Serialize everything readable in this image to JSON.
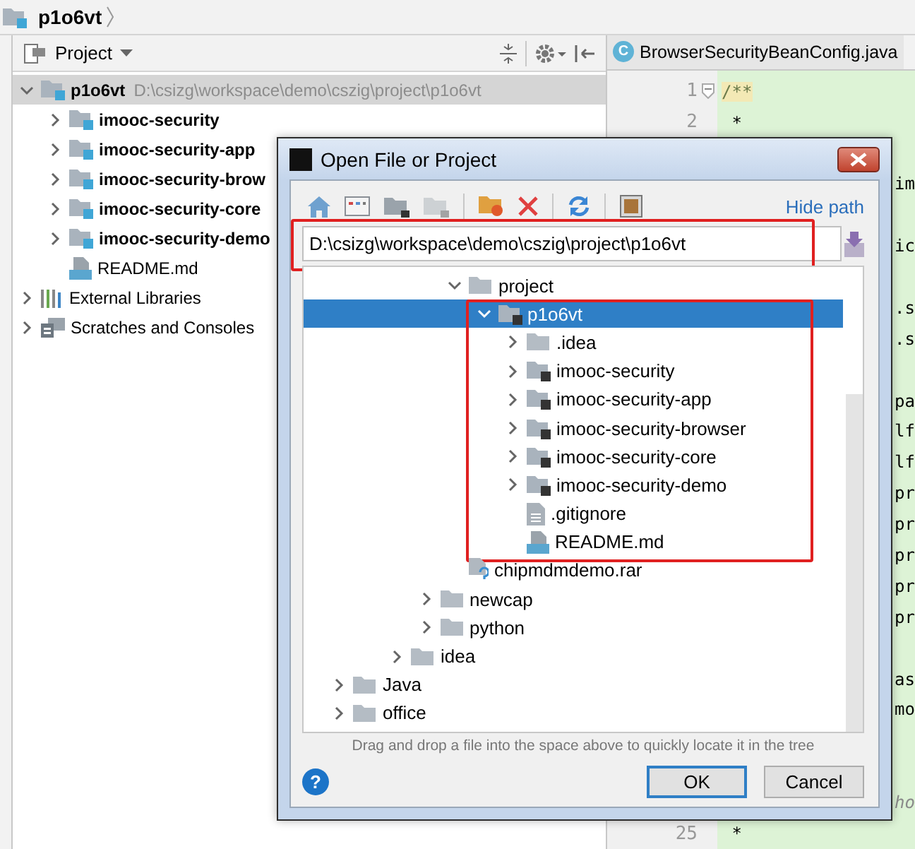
{
  "breadcrumb": {
    "label": "p1o6vt"
  },
  "project_panel": {
    "title": "Project",
    "tree": [
      {
        "label": "p1o6vt",
        "path": "D:\\csizg\\workspace\\demo\\cszig\\project\\p1o6vt",
        "kind": "module",
        "expanded": true,
        "selected": true,
        "children": [
          {
            "label": "imooc-security",
            "kind": "module",
            "expanded": false,
            "selected": false
          },
          {
            "label": "imooc-security-app",
            "kind": "module",
            "expanded": false,
            "selected": false
          },
          {
            "label": "imooc-security-brow",
            "kind": "module",
            "expanded": false,
            "selected": false
          },
          {
            "label": "imooc-security-core",
            "kind": "module",
            "expanded": false,
            "selected": false
          },
          {
            "label": "imooc-security-demo",
            "kind": "module",
            "expanded": false,
            "selected": false
          },
          {
            "label": "README.md",
            "kind": "markdown",
            "selected": false
          }
        ]
      },
      {
        "label": "External Libraries",
        "kind": "libraries",
        "expanded": false,
        "selected": false
      },
      {
        "label": "Scratches and Consoles",
        "kind": "scratches",
        "expanded": false,
        "selected": false
      }
    ]
  },
  "editor": {
    "tab": {
      "label": "BrowserSecurityBeanConfig.java",
      "badge": "C"
    },
    "lines": [
      {
        "number": "1",
        "code": "/**",
        "kind": "full",
        "highlighted": true,
        "fold": true
      },
      {
        "number": "2",
        "code": " *",
        "kind": "full"
      },
      {
        "kind": "covered"
      },
      {
        "code": "im",
        "kind": "tail"
      },
      {
        "kind": "covered"
      },
      {
        "code": "ic",
        "kind": "tail"
      },
      {
        "kind": "covered"
      },
      {
        "code": ".s",
        "kind": "tail"
      },
      {
        "code": ".s",
        "kind": "tail"
      },
      {
        "kind": "covered"
      },
      {
        "code": "pa",
        "kind": "tail"
      },
      {
        "code": "lf",
        "kind": "tail"
      },
      {
        "code": "lf",
        "kind": "tail"
      },
      {
        "code": "pr",
        "kind": "tail"
      },
      {
        "code": "pr",
        "kind": "tail"
      },
      {
        "code": "pr",
        "kind": "tail"
      },
      {
        "code": "pr",
        "kind": "tail"
      },
      {
        "code": "pr",
        "kind": "tail"
      },
      {
        "kind": "covered"
      },
      {
        "code": "as",
        "kind": "tail"
      },
      {
        "code": "mo",
        "kind": "tail"
      },
      {
        "kind": "covered"
      },
      {
        "kind": "covered"
      },
      {
        "code": "ho",
        "kind": "tail",
        "italic": true
      },
      {
        "number": "25",
        "code": " *",
        "kind": "full"
      }
    ]
  },
  "dialog": {
    "title": "Open File or Project",
    "toolbar": [
      {
        "kind": "home",
        "disabled": false
      },
      {
        "kind": "desktop",
        "disabled": false
      },
      {
        "kind": "folder",
        "disabled": false
      },
      {
        "kind": "folder",
        "disabled": true
      },
      {
        "kind": "new-folder",
        "disabled": false
      },
      {
        "kind": "delete",
        "disabled": false
      },
      {
        "kind": "refresh",
        "disabled": false
      },
      {
        "kind": "hidden-files",
        "disabled": false
      }
    ],
    "hide_path_link": "Hide path",
    "path_field": {
      "value": "D:\\csizg\\workspace\\demo\\cszig\\project\\p1o6vt",
      "highlighted": true
    },
    "tree": [
      {
        "children": [
          {
            "children": [
              {
                "children": [
                  {
                    "children": [
                      {
                        "label": "project",
                        "kind": "folder",
                        "expanded": true,
                        "selected": false,
                        "children": [
                          {
                            "label": "p1o6vt",
                            "kind": "module",
                            "expanded": true,
                            "selected": true,
                            "highlighted": true,
                            "children": [
                              {
                                "label": ".idea",
                                "kind": "folder",
                                "expanded": false,
                                "selected": false
                              },
                              {
                                "label": "imooc-security",
                                "kind": "module",
                                "expanded": false,
                                "selected": false
                              },
                              {
                                "label": "imooc-security-app",
                                "kind": "module",
                                "expanded": false,
                                "selected": false
                              },
                              {
                                "label": "imooc-security-browser",
                                "kind": "module",
                                "expanded": false,
                                "selected": false
                              },
                              {
                                "label": "imooc-security-core",
                                "kind": "module",
                                "expanded": false,
                                "selected": false
                              },
                              {
                                "label": "imooc-security-demo",
                                "kind": "module",
                                "expanded": false,
                                "selected": false
                              },
                              {
                                "label": ".gitignore",
                                "kind": "text",
                                "selected": false
                              },
                              {
                                "label": "README.md",
                                "kind": "markdown",
                                "selected": false
                              }
                            ]
                          }
                        ]
                      },
                      {
                        "label": "chipmdmdemo.rar",
                        "kind": "archive",
                        "selected": false
                      }
                    ]
                  },
                  {
                    "label": "newcap",
                    "kind": "folder",
                    "expanded": false,
                    "selected": false
                  },
                  {
                    "label": "python",
                    "kind": "folder",
                    "expanded": false,
                    "selected": false
                  }
                ]
              },
              {
                "label": "idea",
                "kind": "folder",
                "expanded": false,
                "selected": false
              }
            ]
          }
        ]
      },
      {
        "label": "Java",
        "kind": "folder",
        "expanded": false,
        "selected": false
      },
      {
        "label": "office",
        "kind": "folder",
        "expanded": false,
        "selected": false
      }
    ],
    "hint": "Drag and drop a file into the space above to quickly locate it in the tree",
    "help_button": "?",
    "buttons": [
      {
        "label": "OK",
        "default": true
      },
      {
        "label": "Cancel",
        "default": false
      }
    ]
  }
}
